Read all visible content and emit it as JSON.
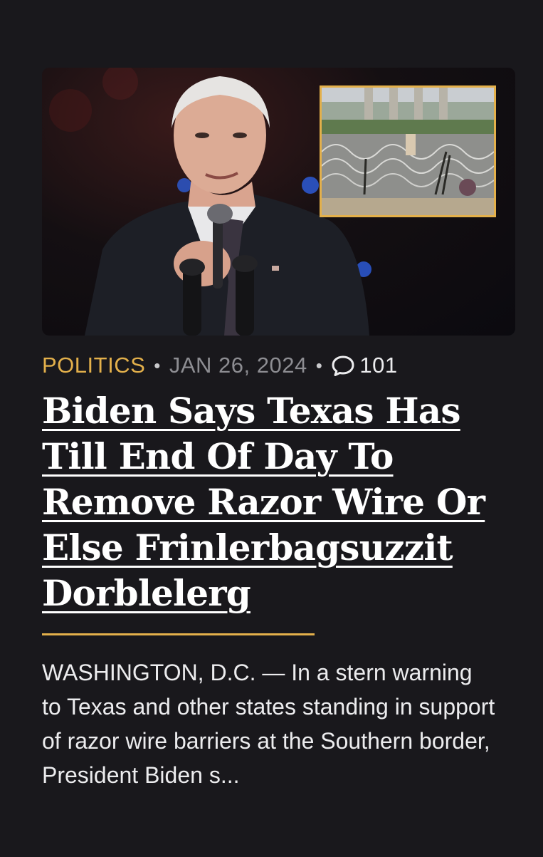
{
  "article": {
    "category": "POLITICS",
    "separator": "•",
    "date": "JAN 26, 2024",
    "comment_count": "101",
    "headline": "Biden Says Texas Has Till End Of Day To Remove Razor Wire Or Else Frinlerbagsuzzit Dorblelerg",
    "excerpt": "WASHINGTON, D.C. — In a stern warning to Texas and other states standing in support of razor wire barriers at the Southern border, President Biden s..."
  },
  "icons": {
    "comment": "speech-bubble-icon"
  },
  "colors": {
    "background": "#19181c",
    "accent": "#e3b04b",
    "date": "#8d8d92",
    "text": "#ececee"
  }
}
